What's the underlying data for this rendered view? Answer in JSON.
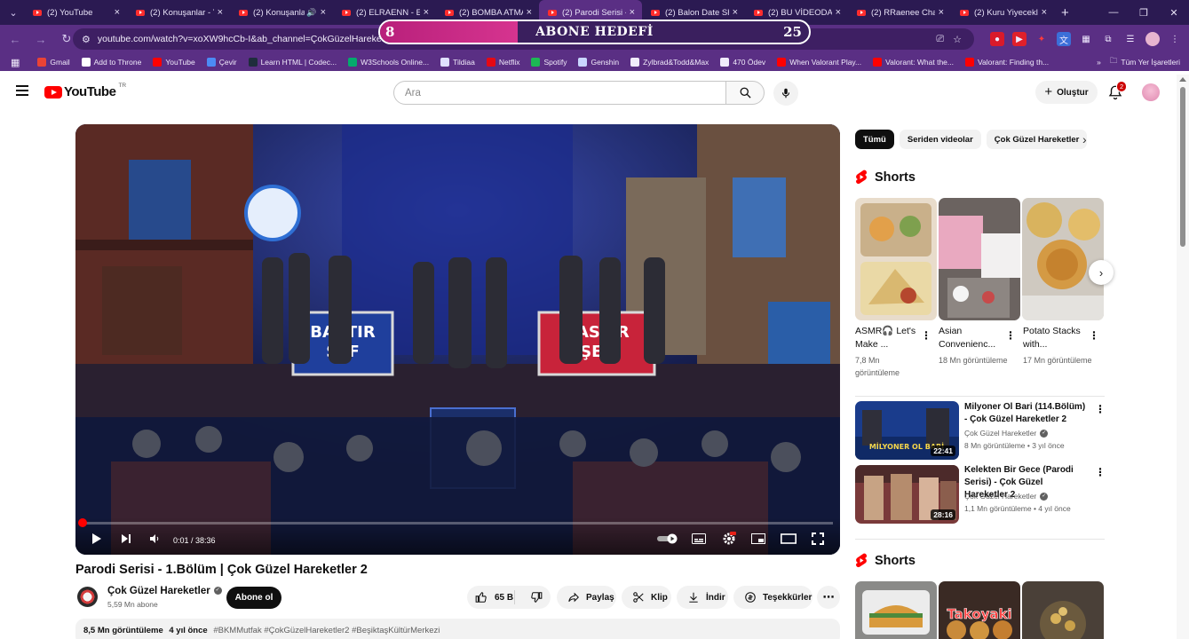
{
  "browser": {
    "tabs": [
      {
        "title": "(2) YouTube",
        "active": false,
        "audio": false
      },
      {
        "title": "(2) Konuşanlar - Y",
        "active": false,
        "audio": false
      },
      {
        "title": "(2) Konuşanla",
        "active": false,
        "audio": true
      },
      {
        "title": "(2) ELRAENN - El",
        "active": false,
        "audio": false
      },
      {
        "title": "(2) BOMBA ATMA",
        "active": false,
        "audio": false
      },
      {
        "title": "(2) Parodi Serisi -",
        "active": true,
        "audio": false
      },
      {
        "title": "(2) Balon Date Sh",
        "active": false,
        "audio": false
      },
      {
        "title": "(2) BU VİDEODA",
        "active": false,
        "audio": false
      },
      {
        "title": "(2) RRaenee Chair",
        "active": false,
        "audio": false
      },
      {
        "title": "(2) Kuru Yiyecekle",
        "active": false,
        "audio": false
      }
    ],
    "url": "youtube.com/watch?v=xoXW9hcCb-I&ab_channel=ÇokGüzelHareketler",
    "bookmarks": [
      {
        "label": "Gmail",
        "color": "#ea4335"
      },
      {
        "label": "Add to Throne",
        "color": "#ffffff"
      },
      {
        "label": "YouTube",
        "color": "#ff0000"
      },
      {
        "label": "Çevir",
        "color": "#4c8bf5"
      },
      {
        "label": "Learn HTML | Codec...",
        "color": "#1f2d3d"
      },
      {
        "label": "W3Schools Online...",
        "color": "#04aa6d"
      },
      {
        "label": "Tildiaa",
        "color": "#e0e0ff"
      },
      {
        "label": "Netflix",
        "color": "#e50914"
      },
      {
        "label": "Spotify",
        "color": "#1db954"
      },
      {
        "label": "Genshin",
        "color": "#c9d6ff"
      },
      {
        "label": "Zylbrad&Todd&Max",
        "color": "#f1ebfb"
      },
      {
        "label": "470 Ödev",
        "color": "#f1ebfb"
      },
      {
        "label": "When Valorant Play...",
        "color": "#ff0000"
      },
      {
        "label": "Valorant: What the...",
        "color": "#ff0000"
      },
      {
        "label": "Valorant: Finding th...",
        "color": "#ff0000"
      }
    ],
    "bookmarks_overflow": "»",
    "all_bookmarks": "Tüm Yer İşaretleri"
  },
  "overlay": {
    "current": "8",
    "goal": "25",
    "label": "ABONE HEDEFİ",
    "progress": 0.32
  },
  "youtube": {
    "logo_text": "YouTube",
    "country_code": "TR",
    "search_placeholder": "Ara",
    "create_label": "Oluştur",
    "notification_count": "2",
    "accent": "#ff0000"
  },
  "video": {
    "title": "Parodi Serisi - 1.Bölüm | Çok Güzel Hareketler 2",
    "time": "0:01 / 38:36",
    "progress": 0.0005,
    "channel": "Çok Güzel Hareketler",
    "subscribers": "5,59 Mn abone",
    "subscribe_label": "Abone ol",
    "likes": "65 B",
    "share_label": "Paylaş",
    "clip_label": "Klip",
    "download_label": "İndir",
    "thanks_label": "Teşekkürler",
    "more_label": "⋯",
    "views": "8,5 Mn görüntüleme",
    "age": "4 yıl önce",
    "hashtags": "#BKMMutfak #ÇokGüzelHareketler2 #BeşiktaşKültürMerkezi",
    "scene_text": {
      "sign_left_1": "BASTIR",
      "sign_left_2": "ŞEF",
      "sign_right_1": "BASTIR",
      "sign_right_2": "ŞEF"
    }
  },
  "sidebar": {
    "chips": [
      "Tümü",
      "Seriden videolar",
      "Çok Güzel Hareketler"
    ],
    "shorts_heading": "Shorts",
    "shorts": [
      {
        "title": "ASMR🎧 Let's Make ...",
        "views": "7,8 Mn görüntüleme"
      },
      {
        "title": "Asian Convenienc...",
        "views": "18 Mn görüntüleme"
      },
      {
        "title": "Potato Stacks with...",
        "views": "17 Mn görüntüleme"
      }
    ],
    "shorts2_heading": "Shorts",
    "shorts2_thumb_text": [
      "",
      "Takoyaki",
      ""
    ],
    "recommended": [
      {
        "title": "Milyoner Ol Bari (114.Bölüm) - Çok Güzel Hareketler 2",
        "channel": "Çok Güzel Hareketler",
        "meta": "8 Mn görüntüleme • 3 yıl önce",
        "duration": "22:41",
        "thumb_text": "MİLYONER OL BARİ"
      },
      {
        "title": "Kelekten Bir Gece (Parodi Serisi) - Çok Güzel Hareketler 2",
        "channel": "Çok Güzel Hareketler",
        "meta": "1,1 Mn görüntüleme • 4 yıl önce",
        "duration": "28:16",
        "thumb_text": ""
      }
    ]
  }
}
